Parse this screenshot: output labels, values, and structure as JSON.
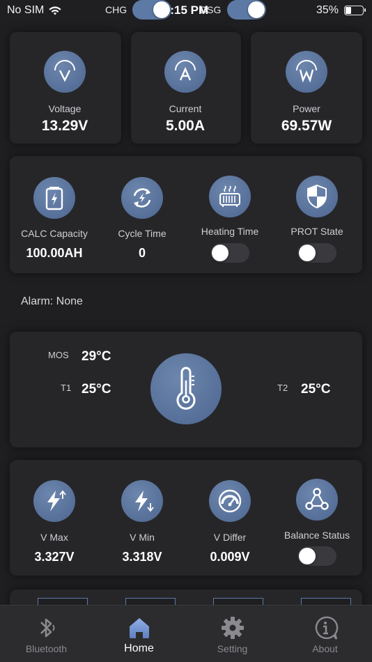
{
  "status_bar": {
    "carrier": "No SIM",
    "time": "4:15 PM",
    "battery_percent": "35%",
    "battery_level": 0.35
  },
  "top_toggles": {
    "chg_label": "CHG",
    "chg_on": true,
    "dsg_label": "DSG",
    "dsg_on": true
  },
  "power_card": {
    "voltage_label": "Voltage",
    "voltage_value": "13.29V",
    "current_label": "Current",
    "current_value": "5.00A",
    "power_label": "Power",
    "power_value": "69.57W"
  },
  "state_card": {
    "capacity_label": "CALC Capacity",
    "capacity_value": "100.00AH",
    "cycle_label": "Cycle Time",
    "cycle_value": "0",
    "heating_label": "Heating Time",
    "heating_on": false,
    "prot_label": "PROT State",
    "prot_on": false
  },
  "alarm": {
    "text": "Alarm: None"
  },
  "temperature_card": {
    "mos_label": "MOS",
    "mos_value": "29°C",
    "t1_label": "T1",
    "t1_value": "25°C",
    "t2_label": "T2",
    "t2_value": "25°C"
  },
  "cell_card": {
    "vmax_label": "V Max",
    "vmax_value": "3.327V",
    "vmin_label": "V Min",
    "vmin_value": "3.318V",
    "vdiffer_label": "V Differ",
    "vdiffer_value": "0.009V",
    "balance_label": "Balance Status",
    "balance_on": false
  },
  "tab_bar": {
    "tabs": [
      {
        "label": "Bluetooth",
        "icon": "bluetooth-icon",
        "active": false
      },
      {
        "label": "Home",
        "icon": "home-icon",
        "active": true
      },
      {
        "label": "Setting",
        "icon": "gear-icon",
        "active": false
      },
      {
        "label": "About",
        "icon": "info-icon",
        "active": false
      }
    ]
  },
  "colors": {
    "background": "#1f1f22",
    "card": "#262629",
    "accent": "#5d7aa6",
    "icon_circle": "#566f98"
  }
}
